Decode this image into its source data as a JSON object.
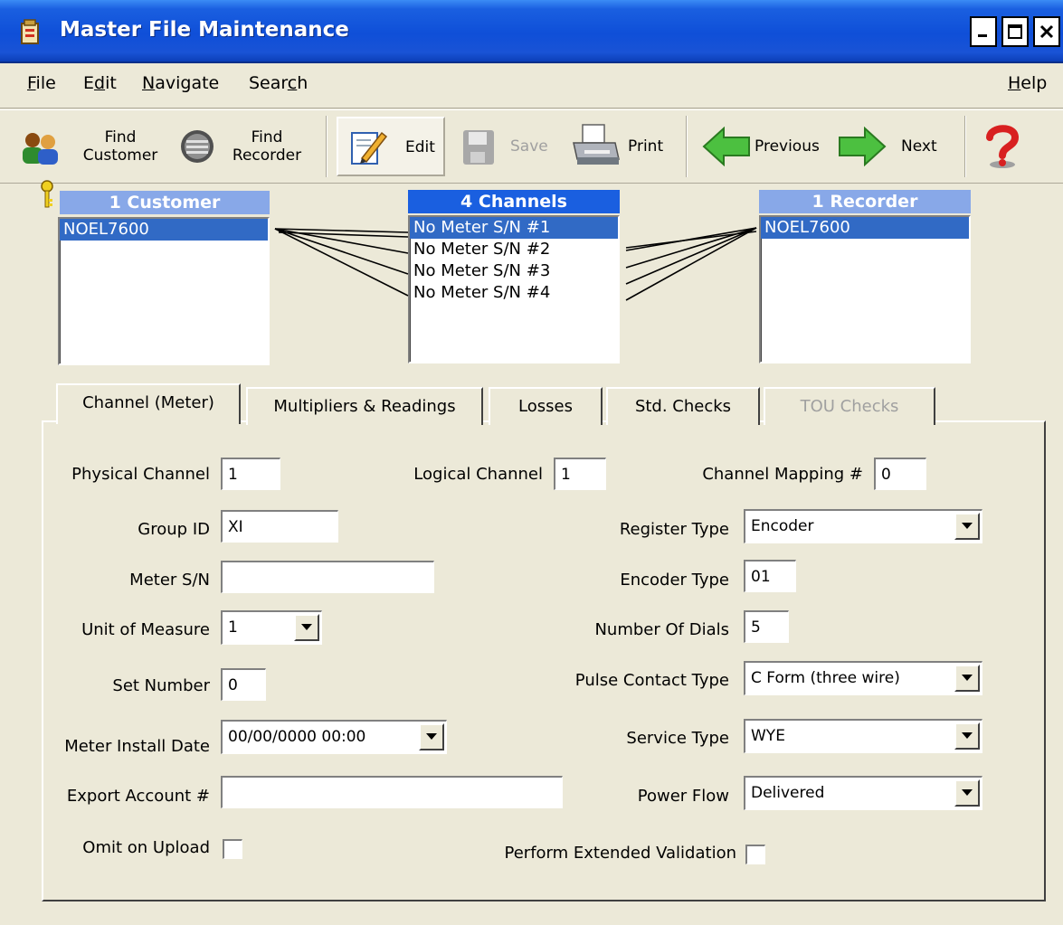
{
  "window": {
    "title": "Master File Maintenance"
  },
  "menu": {
    "file": "File",
    "edit": "Edit",
    "navigate": "Navigate",
    "search": "Search",
    "help": "Help"
  },
  "toolbar": {
    "find_customer_1": "Find",
    "find_customer_2": "Customer",
    "find_recorder_1": "Find",
    "find_recorder_2": "Recorder",
    "edit": "Edit",
    "save": "Save",
    "print": "Print",
    "previous": "Previous",
    "next": "Next"
  },
  "lists": {
    "customer": {
      "header": "1 Customer",
      "items": [
        "NOEL7600"
      ]
    },
    "channels": {
      "header": "4 Channels",
      "items": [
        "No Meter S/N #1",
        "No Meter S/N #2",
        "No Meter S/N #3",
        "No Meter S/N #4"
      ]
    },
    "recorder": {
      "header": "1 Recorder",
      "items": [
        "NOEL7600"
      ]
    }
  },
  "tabs": [
    "Channel (Meter)",
    "Multipliers & Readings",
    "Losses",
    "Std. Checks",
    "TOU Checks"
  ],
  "form": {
    "physical_channel": {
      "label": "Physical Channel",
      "value": "1"
    },
    "logical_channel": {
      "label": "Logical Channel",
      "value": "1"
    },
    "channel_mapping": {
      "label": "Channel Mapping #",
      "value": "0"
    },
    "group_id": {
      "label": "Group ID",
      "value": "XI"
    },
    "register_type": {
      "label": "Register Type",
      "value": "Encoder"
    },
    "meter_sn": {
      "label": "Meter S/N",
      "value": ""
    },
    "encoder_type": {
      "label": "Encoder Type",
      "value": "01"
    },
    "unit_of_measure": {
      "label": "Unit of Measure",
      "value": "1"
    },
    "number_of_dials": {
      "label": "Number Of Dials",
      "value": "5"
    },
    "set_number": {
      "label": "Set Number",
      "value": "0"
    },
    "pulse_contact_type": {
      "label": "Pulse Contact Type",
      "value": "C Form (three wire)"
    },
    "meter_install_date": {
      "label": "Meter Install Date",
      "value": "00/00/0000 00:00"
    },
    "service_type": {
      "label": "Service Type",
      "value": "WYE"
    },
    "export_account": {
      "label": "Export Account #",
      "value": ""
    },
    "power_flow": {
      "label": "Power Flow",
      "value": "Delivered"
    },
    "omit_on_upload": {
      "label": "Omit on Upload",
      "checked": false
    },
    "perform_extended_validation": {
      "label": "Perform Extended Validation",
      "checked": false
    }
  },
  "colors": {
    "titlebar": "#0F4FD8",
    "selection": "#316AC5",
    "list_header": "#4F86E8",
    "dialog": "#ECE9D8"
  }
}
